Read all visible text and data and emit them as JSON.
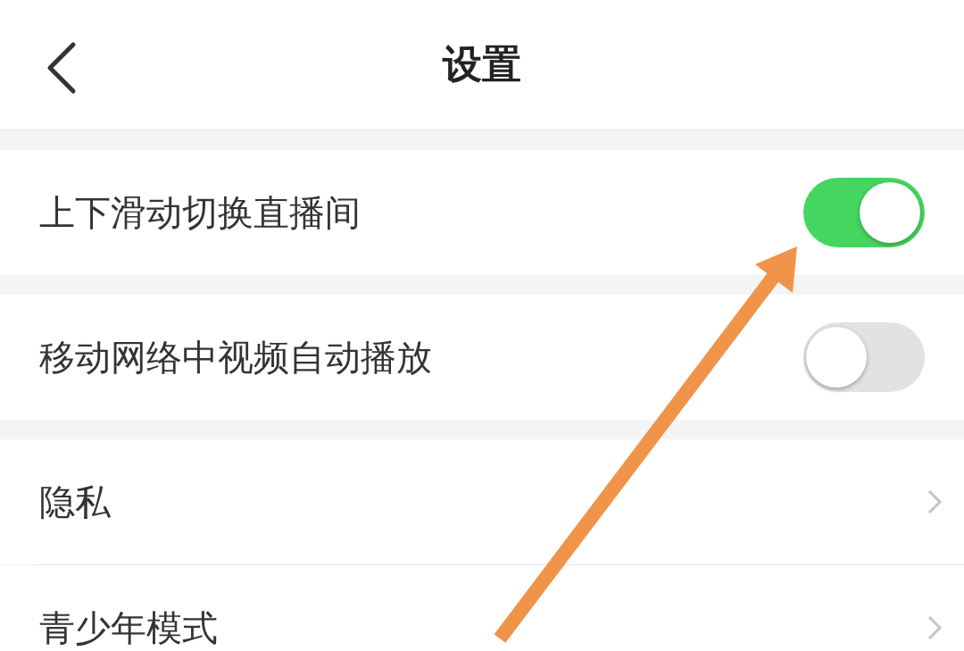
{
  "header": {
    "title": "设置"
  },
  "rows": [
    {
      "kind": "toggle",
      "label": "上下滑动切换直播间",
      "on": true,
      "gap_before": true
    },
    {
      "kind": "toggle",
      "label": "移动网络中视频自动播放",
      "on": false,
      "gap_before": true
    },
    {
      "kind": "link",
      "label": "隐私",
      "gap_before": true
    },
    {
      "kind": "link",
      "label": "青少年模式",
      "gap_before": false
    }
  ]
}
